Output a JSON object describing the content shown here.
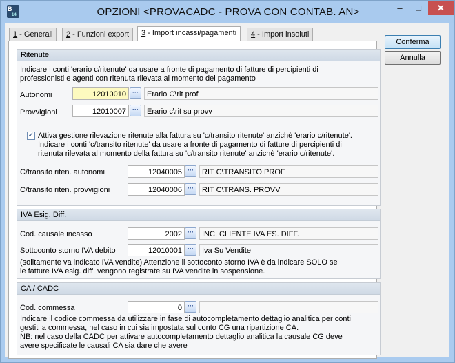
{
  "window": {
    "title": "OPZIONI <PROVACADC - PROVA CON CONTAB. AN>",
    "icon_letter": "B",
    "icon_number": "14",
    "minimize_label": "–",
    "maximize_label": "□",
    "close_label": "✕"
  },
  "tabs": [
    {
      "key": "1",
      "label": " - Generali"
    },
    {
      "key": "2",
      "label": " - Funzioni export"
    },
    {
      "key": "3",
      "label": " - Import incassi/pagamenti"
    },
    {
      "key": "4",
      "label": " - Import insoluti"
    }
  ],
  "buttons": {
    "confirm": "Conferma",
    "cancel": "Annulla"
  },
  "ritenute": {
    "header": "Ritenute",
    "intro_line1": "Indicare i conti 'erario c/ritenute' da usare a fronte di pagamento di fatture di percipienti di",
    "intro_line2": "professionisti e agenti con ritenuta rilevata al momento del pagamento",
    "autonomi_label": "Autonomi",
    "autonomi_value": "12010010",
    "autonomi_desc": "Erario C\\rit prof",
    "provvigioni_label": "Provvigioni",
    "provvigioni_value": "12010007",
    "provvigioni_desc": "Erario c\\rit su provv",
    "check_label": "Attiva gestione rilevazione ritenute alla fattura su 'c/transito ritenute' anzichè 'erario c/ritenute'.",
    "check_line2": "Indicare i conti 'c/transito ritenute' da usare a fronte di pagamento di fatture di percipienti di",
    "check_line3": "ritenuta rilevata al momento della fattura su  'c/transito ritenute' anzichè 'erario c/ritenute'.",
    "transito_autonomi_label": "C/transito riten. autonomi",
    "transito_autonomi_value": "12040005",
    "transito_autonomi_desc": "RIT C\\TRANSITO PROF",
    "transito_provvigioni_label": "C/transito riten. provvigioni",
    "transito_provvigioni_value": "12040006",
    "transito_provvigioni_desc": "RIT C\\TRANS. PROVV"
  },
  "iva": {
    "header": "IVA Esig. Diff.",
    "causale_label": "Cod. causale incasso",
    "causale_value": "2002",
    "causale_desc": "INC. CLIENTE IVA ES. DIFF.",
    "storno_label": "Sottoconto storno IVA debito",
    "storno_value": "12010001",
    "storno_desc": "Iva Su Vendite",
    "note_line1": "(solitamente va indicato IVA vendite) Attenzione il sottoconto storno IVA è da indicare SOLO se",
    "note_line2": "le fatture IVA esig. diff. vengono registrate su IVA vendite in sospensione."
  },
  "cadc": {
    "header": "CA / CADC",
    "commessa_label": "Cod. commessa",
    "commessa_value": "0",
    "commessa_desc": "",
    "note_line1": "Indicare il codice commessa da utilizzare in fase di autocompletamento dettaglio analitica per conti",
    "note_line2": "gestiti a commessa, nel caso in cui sia impostata sul conto CG una ripartizione CA.",
    "note_line3": "NB: nel caso della CADC per attivare autocompletamento dettaglio analitica  la causale CG deve",
    "note_line4": "avere specificate le causali CA sia dare che avere"
  },
  "icons": {
    "lookup": "ellipsis-icon",
    "checkbox_checked": true
  }
}
